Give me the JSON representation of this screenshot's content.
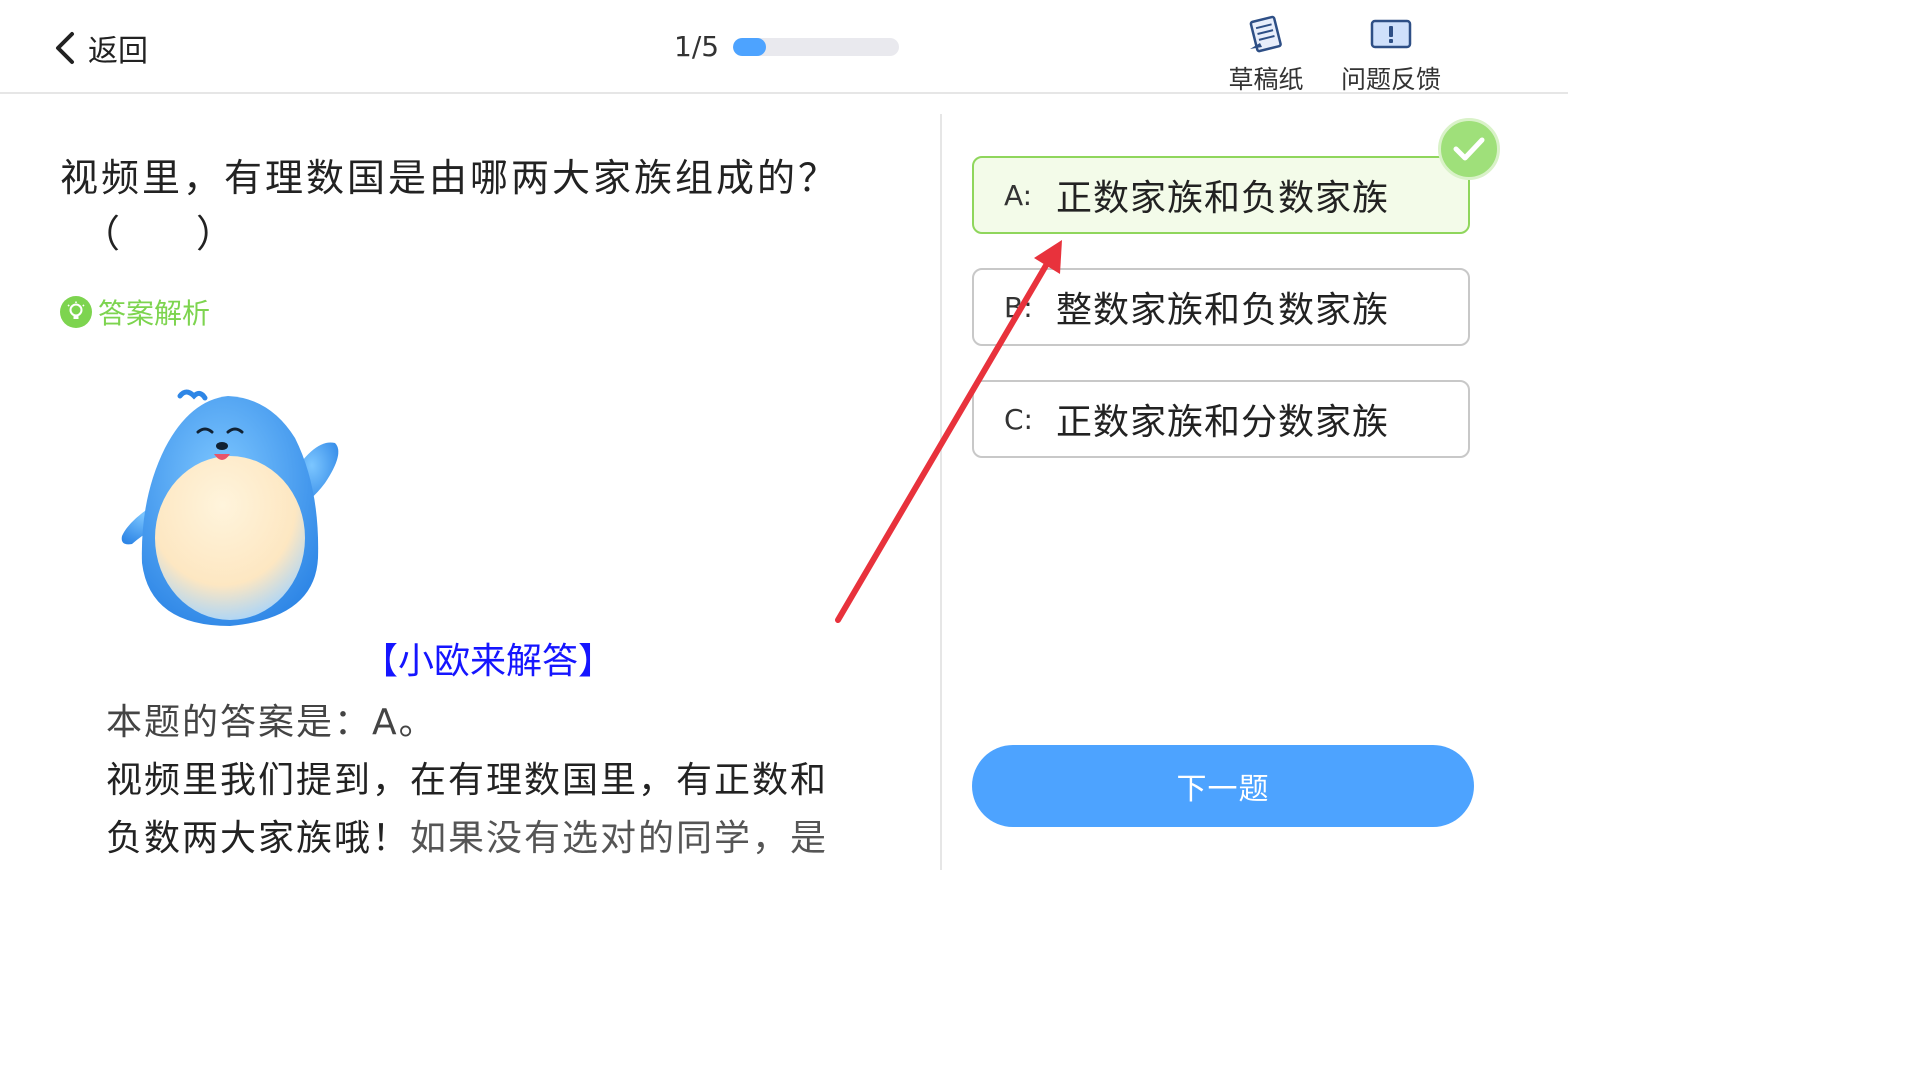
{
  "header": {
    "back_label": "返回",
    "progress_text": "1/5",
    "progress_fraction": 0.2,
    "tools": [
      {
        "label": "草稿纸",
        "icon": "draft-paper-icon"
      },
      {
        "label": "问题反馈",
        "icon": "feedback-icon"
      }
    ]
  },
  "question": {
    "text": "视频里，有理数国是由哪两大家族组成的？",
    "blank": "（　　）"
  },
  "analysis": {
    "label": "答案解析",
    "icon": "lightbulb-icon"
  },
  "answer": {
    "title": "【小欧来解答】",
    "line1": "本题的答案是：A。",
    "line2": "视频里我们提到，在有理数国里，有正数和",
    "line3_a": "负数两大家族哦！",
    "line3_b": "如果没有选对的同学，是"
  },
  "options": [
    {
      "key": "A:",
      "text": "正数家族和负数家族",
      "state": "correct"
    },
    {
      "key": "B:",
      "text": "整数家族和负数家族",
      "state": "default"
    },
    {
      "key": "C:",
      "text": "正数家族和分数家族",
      "state": "default"
    }
  ],
  "next_button": "下一题",
  "colors": {
    "accent_blue": "#4da3ff",
    "correct_green": "#8fd65c",
    "analysis_green": "#7dd44f",
    "annotation_red": "#e8323c",
    "answer_title_blue": "#1515ff"
  }
}
